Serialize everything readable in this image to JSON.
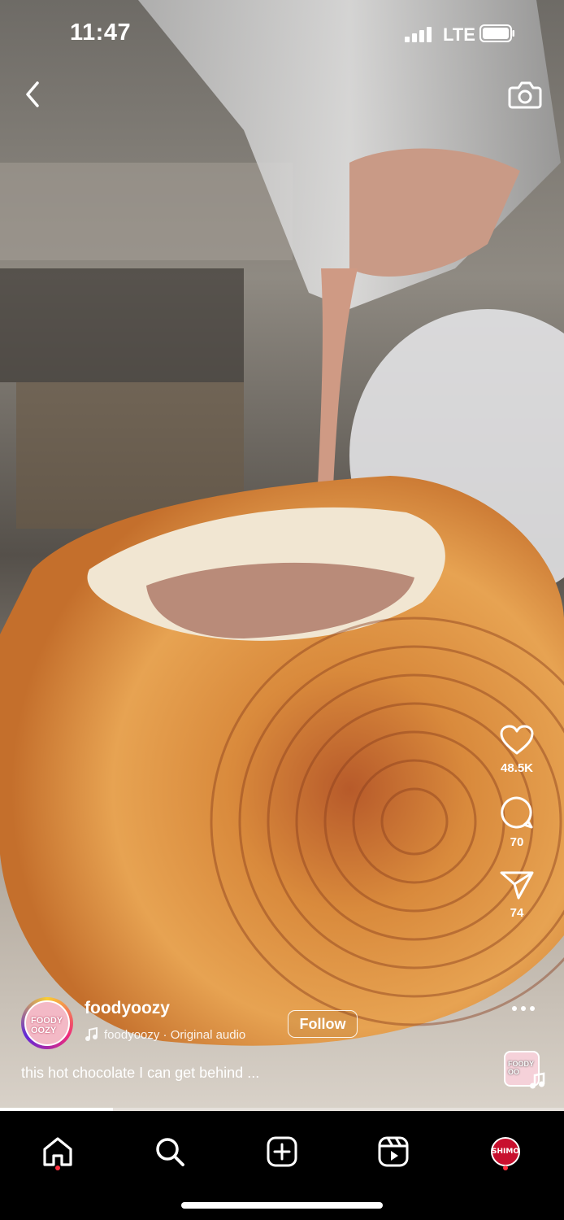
{
  "status_bar": {
    "time": "11:47",
    "network": "LTE"
  },
  "post": {
    "username": "foodyoozy",
    "avatar_text": "FOODY OOZY",
    "audio": "foodyoozy · Original audio",
    "follow_label": "Follow",
    "caption": "this hot chocolate I can get behind ...",
    "audio_thumb_text": "FOODY OO"
  },
  "actions": {
    "likes": "48.5K",
    "comments": "70",
    "shares": "74"
  },
  "progress_fraction": 0.2,
  "nav": {
    "profile_text": "SHIMO"
  },
  "icons": [
    "back-icon",
    "camera-icon",
    "heart-icon",
    "comment-icon",
    "share-icon",
    "more-icon",
    "music-note-icon",
    "home-icon",
    "search-icon",
    "create-icon",
    "reels-icon"
  ],
  "colors": {
    "accent_red": "#ff3040",
    "nav_bg": "#000000"
  }
}
